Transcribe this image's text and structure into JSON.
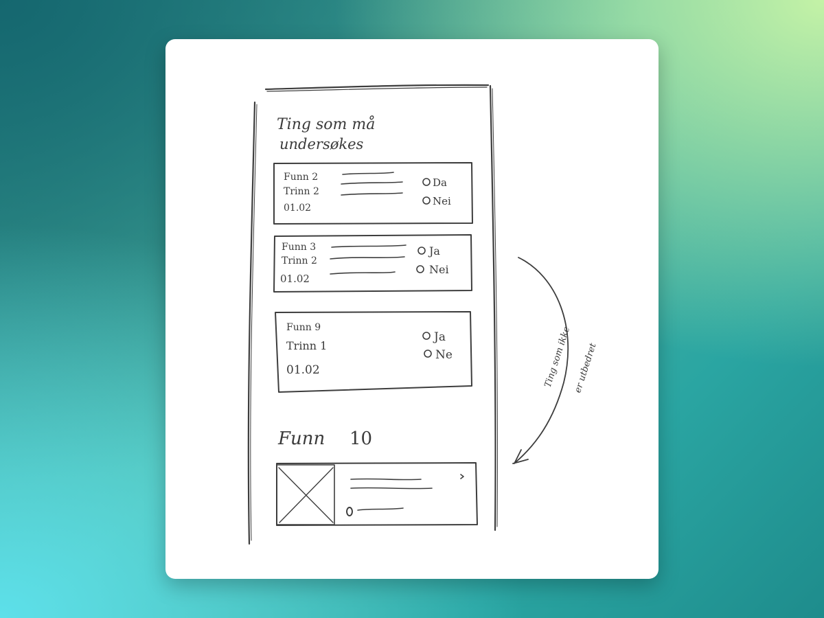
{
  "sketch": {
    "heading_line1": "Ting som må",
    "heading_line2": "undersøkes",
    "cards": [
      {
        "title": "Funn 2",
        "step": "Trinn 2",
        "date": "01.02",
        "yes": "Da",
        "no": "Nei"
      },
      {
        "title": "Funn 3",
        "step": "Trinn 2",
        "date": "01.02",
        "yes": "Ja",
        "no": "Nei"
      },
      {
        "title": "Funn 9",
        "step": "Trinn 1",
        "date": "01.02",
        "yes": "Ja",
        "no": "Ne"
      }
    ],
    "section_title": "Funn",
    "section_count": "10",
    "side_note_line1": "Ting som ikke",
    "side_note_line2": "er utbedret"
  }
}
